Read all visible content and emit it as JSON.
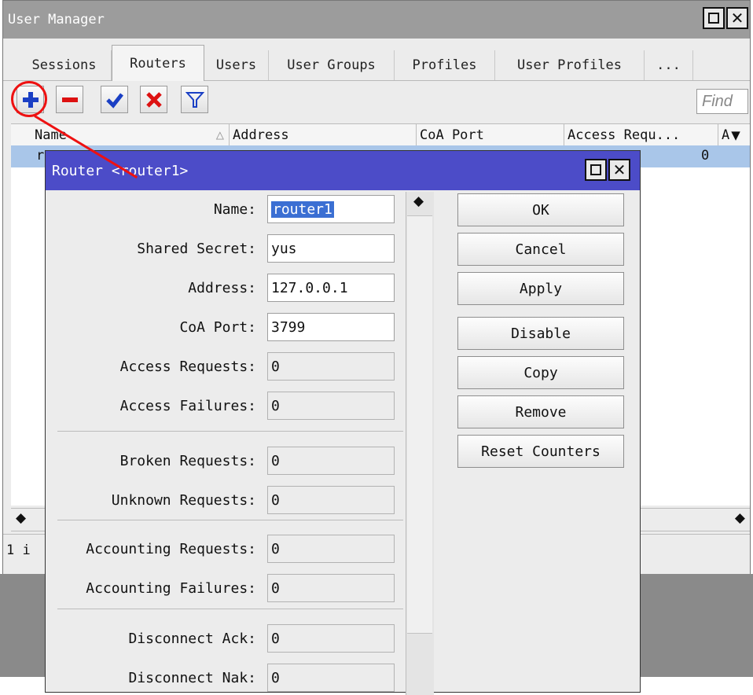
{
  "window": {
    "title": "User Manager"
  },
  "tabs": [
    {
      "label": "Sessions"
    },
    {
      "label": "Routers"
    },
    {
      "label": "Users"
    },
    {
      "label": "User Groups"
    },
    {
      "label": "Profiles"
    },
    {
      "label": "User Profiles"
    },
    {
      "label": "..."
    }
  ],
  "toolbar": {
    "find_placeholder": "Find"
  },
  "grid": {
    "columns": {
      "name": "Name",
      "address": "Address",
      "coa_port": "CoA Port",
      "access_requests": "Access Requ...",
      "more": "A"
    },
    "rows": [
      {
        "name": "r",
        "access_requests": "0"
      }
    ]
  },
  "status": {
    "count": "1 i"
  },
  "dialog": {
    "title": "Router <router1>",
    "fields": {
      "name": {
        "label": "Name:",
        "value": "router1"
      },
      "shared_secret": {
        "label": "Shared Secret:",
        "value": "yus"
      },
      "address": {
        "label": "Address:",
        "value": "127.0.0.1"
      },
      "coa_port": {
        "label": "CoA Port:",
        "value": "3799"
      },
      "access_requests": {
        "label": "Access Requests:",
        "value": "0"
      },
      "access_failures": {
        "label": "Access Failures:",
        "value": "0"
      },
      "broken_requests": {
        "label": "Broken Requests:",
        "value": "0"
      },
      "unknown_requests": {
        "label": "Unknown Requests:",
        "value": "0"
      },
      "accounting_requests": {
        "label": "Accounting Requests:",
        "value": "0"
      },
      "accounting_failures": {
        "label": "Accounting Failures:",
        "value": "0"
      },
      "disconnect_ack": {
        "label": "Disconnect Ack:",
        "value": "0"
      },
      "disconnect_nak": {
        "label": "Disconnect Nak:",
        "value": "0"
      }
    },
    "buttons": {
      "ok": "OK",
      "cancel": "Cancel",
      "apply": "Apply",
      "disable": "Disable",
      "copy": "Copy",
      "remove": "Remove",
      "reset_counters": "Reset Counters"
    }
  },
  "icons": {
    "add": "plus-icon",
    "remove": "minus-icon",
    "enable": "check-icon",
    "disable": "x-icon",
    "filter": "filter-icon"
  },
  "colors": {
    "dialog_title": "#4c4cc8",
    "selected_row": "#a9c6e9",
    "annotation": "#e11111"
  }
}
